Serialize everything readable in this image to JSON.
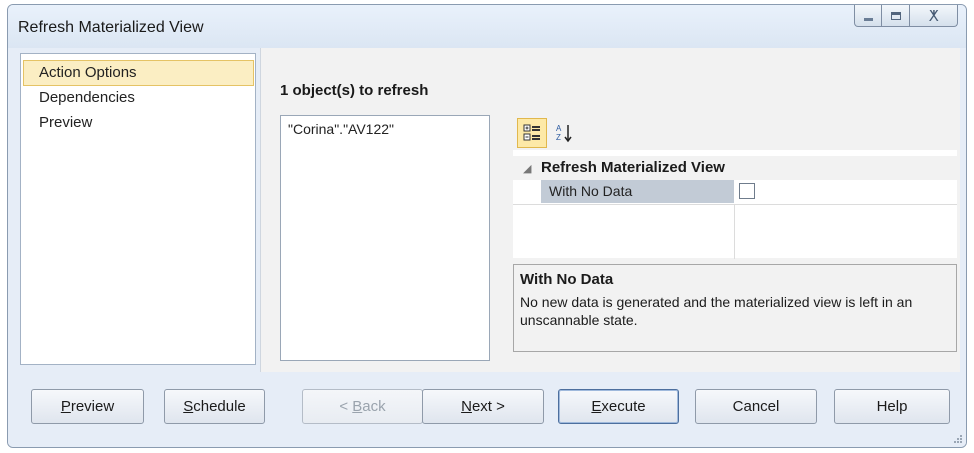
{
  "window": {
    "title": "Refresh Materialized View",
    "controls": {
      "min_icon": "minimize-icon",
      "max_icon": "maximize-icon",
      "close_glyph": "ⵅ"
    }
  },
  "nav": {
    "items": [
      {
        "label": "Action Options",
        "selected": true
      },
      {
        "label": "Dependencies",
        "selected": false
      },
      {
        "label": "Preview",
        "selected": false
      }
    ]
  },
  "content": {
    "objects_title": "1 object(s) to refresh",
    "objects": [
      "\"Corina\".\"AV122\""
    ],
    "toolbar": {
      "categorized_icon": "categorized-view-icon",
      "alphabetical_icon": "sort-alphabetical-icon"
    },
    "grid": {
      "category": "Refresh Materialized View",
      "collapse_glyph": "◢",
      "properties": [
        {
          "name": "With No Data",
          "checked": false
        }
      ]
    },
    "help": {
      "title": "With No Data",
      "description": "No new data is generated and the materialized view is left in an unscannable state."
    }
  },
  "buttons": {
    "preview": {
      "mnemonic": "P",
      "rest": "review"
    },
    "schedule": {
      "mnemonic": "S",
      "rest": "chedule"
    },
    "back": {
      "prefix": "< ",
      "mnemonic": "B",
      "rest": "ack"
    },
    "next": {
      "mnemonic": "N",
      "rest": "ext >"
    },
    "execute": {
      "mnemonic": "E",
      "rest": "xecute"
    },
    "cancel": "Cancel",
    "help": "Help"
  },
  "colors": {
    "selection_fill": "#fbeec3",
    "selection_border": "#e5c365",
    "property_name_fill": "#c2cbd6",
    "dialog_background": "#e6edf7"
  }
}
